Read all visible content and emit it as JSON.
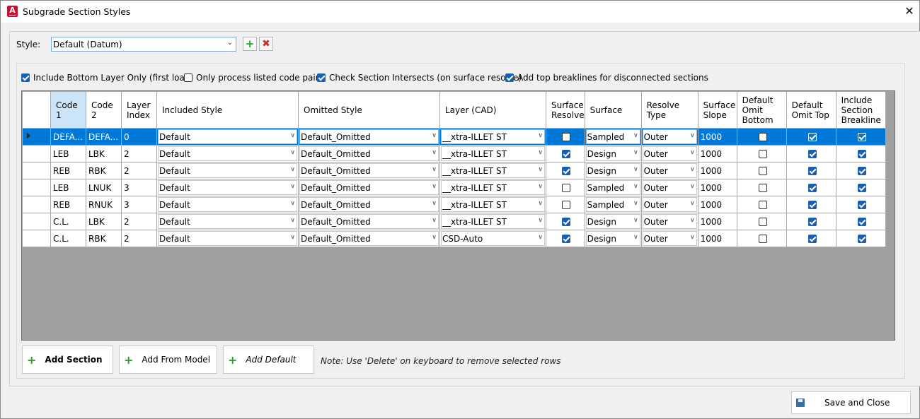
{
  "window": {
    "title": "Subgrade Section Styles",
    "close_glyph": "✕",
    "app_icon_letter": "A"
  },
  "style": {
    "label": "Style:",
    "value": "Default (Datum)",
    "add_icon": "plus-icon",
    "delete_icon": "delete-x-icon"
  },
  "options": [
    {
      "label": "Include Bottom Layer Only (first load)",
      "checked": true
    },
    {
      "label": "Only process listed code pairs",
      "checked": false
    },
    {
      "label": "Check Section Intersects (on surface resolve)",
      "checked": true
    },
    {
      "label": "Add top breaklines for disconnected sections",
      "checked": true
    }
  ],
  "grid": {
    "columns": [
      "Code 1",
      "Code 2",
      "Layer Index",
      "Included Style",
      "Omitted Style",
      "Layer (CAD)",
      "Surface Resolve",
      "Surface",
      "Resolve Type",
      "Surface Slope",
      "Default Omit Bottom",
      "Default Omit Top",
      "Include Section Breakline"
    ],
    "rows": [
      {
        "code1": "DEFA...",
        "code2": "DEFA...",
        "layer_index": "0",
        "included": "Default",
        "omitted": "Default_Omitted",
        "layer": "__xtra-ILLET ST",
        "surface_resolve": false,
        "surface": "Sampled",
        "resolve_type": "Outer",
        "slope": "1000",
        "omit_bottom": false,
        "omit_top": true,
        "breakline": true
      },
      {
        "code1": "LEB",
        "code2": "LBK",
        "layer_index": "2",
        "included": "Default",
        "omitted": "Default_Omitted",
        "layer": "__xtra-ILLET ST",
        "surface_resolve": true,
        "surface": "Design",
        "resolve_type": "Outer",
        "slope": "1000",
        "omit_bottom": false,
        "omit_top": true,
        "breakline": true
      },
      {
        "code1": "REB",
        "code2": "RBK",
        "layer_index": "2",
        "included": "Default",
        "omitted": "Default_Omitted",
        "layer": "__xtra-ILLET ST",
        "surface_resolve": true,
        "surface": "Design",
        "resolve_type": "Outer",
        "slope": "1000",
        "omit_bottom": false,
        "omit_top": true,
        "breakline": true
      },
      {
        "code1": "LEB",
        "code2": "LNUK",
        "layer_index": "3",
        "included": "Default",
        "omitted": "Default_Omitted",
        "layer": "__xtra-ILLET ST",
        "surface_resolve": false,
        "surface": "Sampled",
        "resolve_type": "Outer",
        "slope": "1000",
        "omit_bottom": false,
        "omit_top": true,
        "breakline": true
      },
      {
        "code1": "REB",
        "code2": "RNUK",
        "layer_index": "3",
        "included": "Default",
        "omitted": "Default_Omitted",
        "layer": "__xtra-ILLET ST",
        "surface_resolve": false,
        "surface": "Sampled",
        "resolve_type": "Outer",
        "slope": "1000",
        "omit_bottom": false,
        "omit_top": true,
        "breakline": true
      },
      {
        "code1": "C.L.",
        "code2": "LBK",
        "layer_index": "2",
        "included": "Default",
        "omitted": "Default_Omitted",
        "layer": "__xtra-ILLET ST",
        "surface_resolve": true,
        "surface": "Design",
        "resolve_type": "Outer",
        "slope": "1000",
        "omit_bottom": false,
        "omit_top": true,
        "breakline": true
      },
      {
        "code1": "C.L.",
        "code2": "RBK",
        "layer_index": "2",
        "included": "Default",
        "omitted": "Default_Omitted",
        "layer": "CSD-Auto",
        "surface_resolve": true,
        "surface": "Design",
        "resolve_type": "Outer",
        "slope": "1000",
        "omit_bottom": false,
        "omit_top": true,
        "breakline": true
      }
    ]
  },
  "buttons": {
    "add_section": "Add Section",
    "add_from_model": "Add From Model",
    "add_default": "Add Default",
    "save_close": "Save and Close"
  },
  "note": "Note: Use 'Delete' on keyboard to remove selected rows",
  "colors": {
    "selection": "#0078d7",
    "accent_plus": "#2e9b2e",
    "delete_red": "#c0392b"
  }
}
